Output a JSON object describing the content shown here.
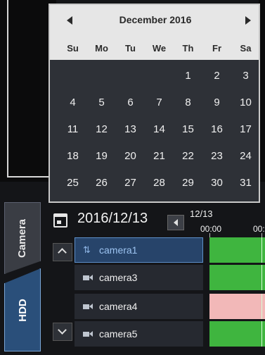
{
  "calendar": {
    "month_title": "December 2016",
    "weekdays": [
      "Su",
      "Mo",
      "Tu",
      "We",
      "Th",
      "Fr",
      "Sa"
    ],
    "weeks": [
      [
        "",
        "",
        "",
        "",
        "1",
        "2",
        "3"
      ],
      [
        "4",
        "5",
        "6",
        "7",
        "8",
        "9",
        "10"
      ],
      [
        "11",
        "12",
        "13",
        "14",
        "15",
        "16",
        "17"
      ],
      [
        "18",
        "19",
        "20",
        "21",
        "22",
        "23",
        "24"
      ],
      [
        "25",
        "26",
        "27",
        "28",
        "29",
        "30",
        "31"
      ]
    ]
  },
  "side_tabs": {
    "camera": "Camera",
    "hdd": "HDD"
  },
  "date_bar": {
    "date": "2016/12/13",
    "timeline_date": "12/13",
    "time_1": "00:00",
    "time_2": "00:"
  },
  "cameras": [
    {
      "name": "camera1",
      "icon": "ptz-camera-icon",
      "status_color": "#3fb53f"
    },
    {
      "name": "camera3",
      "icon": "camera-icon",
      "status_color": "#3fb53f"
    },
    {
      "name": "camera4",
      "icon": "camera-icon",
      "status_color": "#f2b8b8"
    },
    {
      "name": "camera5",
      "icon": "camera-icon",
      "status_color": "#3fb53f"
    }
  ],
  "colors": {
    "accent": "#2a4f7a",
    "recorded": "#3fb53f",
    "alarm": "#f2b8b8"
  }
}
